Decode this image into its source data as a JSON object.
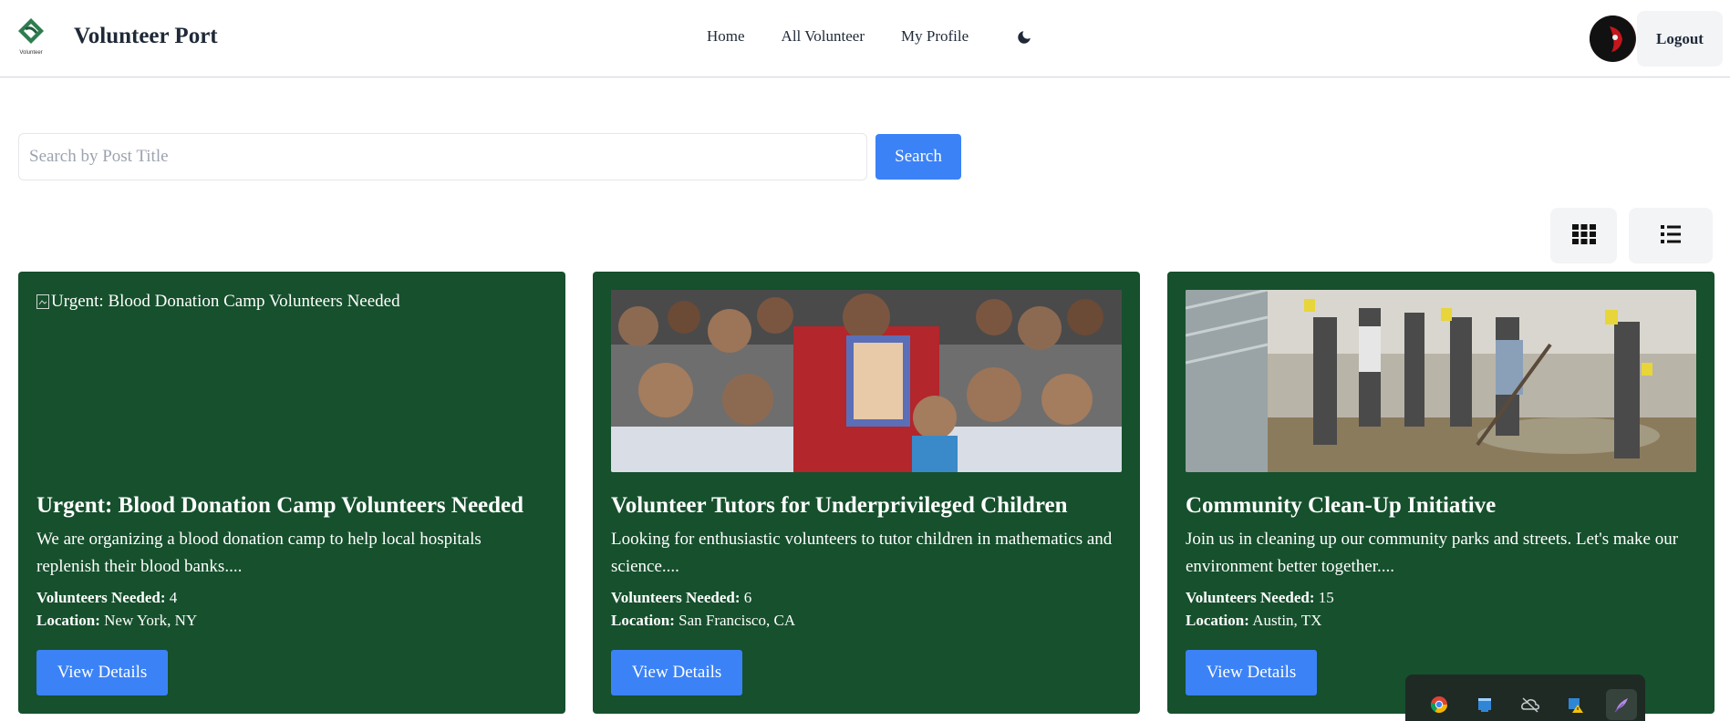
{
  "navbar": {
    "brand": "Volunteer Port",
    "logo_caption": "Volunteer",
    "links": [
      "Home",
      "All Volunteer",
      "My Profile"
    ],
    "theme_icon": "moon-icon",
    "logout_label": "Logout"
  },
  "search": {
    "placeholder": "Search by Post Title",
    "value": "",
    "button_label": "Search"
  },
  "view_toggle": {
    "grid_icon": "grid-icon",
    "list_icon": "list-icon"
  },
  "cards": [
    {
      "image_alt": "Urgent: Blood Donation Camp Volunteers Needed",
      "image_loaded": false,
      "title": "Urgent: Blood Donation Camp Volunteers Needed",
      "description": "We are organizing a blood donation camp to help local hospitals replenish their blood banks....",
      "needed_label": "Volunteers Needed:",
      "needed_value": "4",
      "location_label": "Location:",
      "location_value": "New York, NY",
      "button_label": "View Details"
    },
    {
      "image_alt": "Volunteer Tutors for Underprivileged Children",
      "image_loaded": true,
      "title": "Volunteer Tutors for Underprivileged Children",
      "description": "Looking for enthusiastic volunteers to tutor children in mathematics and science....",
      "needed_label": "Volunteers Needed:",
      "needed_value": "6",
      "location_label": "Location:",
      "location_value": "San Francisco, CA",
      "button_label": "View Details"
    },
    {
      "image_alt": "Community Clean-Up Initiative",
      "image_loaded": true,
      "title": "Community Clean-Up Initiative",
      "description": "Join us in cleaning up our community parks and streets. Let's make our environment better together....",
      "needed_label": "Volunteers Needed:",
      "needed_value": "15",
      "location_label": "Location:",
      "location_value": "Austin, TX",
      "button_label": "View Details"
    }
  ],
  "taskbar": {
    "icons": [
      "chrome-icon",
      "app-window-icon",
      "cloud-off-icon",
      "shield-warning-icon",
      "feather-icon"
    ]
  },
  "colors": {
    "card_bg": "#16502d",
    "accent": "#3b82f6",
    "nav_button_bg": "#f3f4f6"
  }
}
